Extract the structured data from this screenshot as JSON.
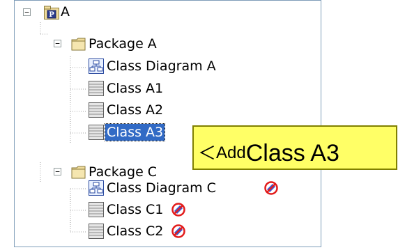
{
  "tree": {
    "root": {
      "label": "A",
      "badge": "P",
      "expander": "−"
    },
    "package_a": {
      "label": "Package A",
      "expander": "−"
    },
    "package_a_children": [
      {
        "label": "Class Diagram A",
        "kind": "diagram"
      },
      {
        "label": "Class A1",
        "kind": "class"
      },
      {
        "label": "Class A2",
        "kind": "class"
      },
      {
        "label": "Class A3",
        "kind": "class",
        "selected": true
      }
    ],
    "package_c": {
      "label": "Package C",
      "expander": "−"
    },
    "package_c_children": [
      {
        "label": "Class Diagram C",
        "kind": "diagram",
        "status": "not-editable-icon"
      },
      {
        "label": "Class C1",
        "kind": "class",
        "status": "not-editable-icon"
      },
      {
        "label": "Class C2",
        "kind": "class",
        "status": "not-editable-icon"
      }
    ]
  },
  "callout": {
    "prefix": "＜",
    "text_a": "Add ",
    "text_b": "Class A3"
  },
  "colors": {
    "selection": "#316ac5",
    "callout_bg": "#ffff66",
    "folder": "#f0dc9c",
    "status_blue": "#3a5bd8",
    "status_red": "#e21b1b"
  },
  "icons": {
    "package_root": "package-badge-icon",
    "folder": "folder-icon",
    "diagram": "class-diagram-icon",
    "class": "class-icon",
    "status": "not-editable-icon"
  }
}
